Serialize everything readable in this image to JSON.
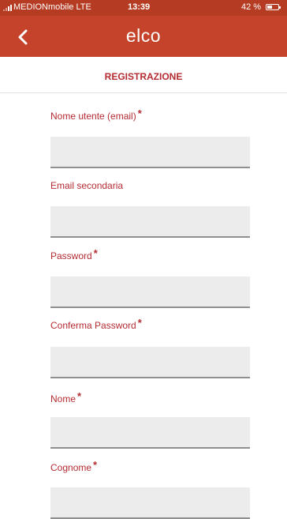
{
  "status_bar": {
    "carrier": "MEDIONmobile  LTE",
    "time": "13:39",
    "battery": "42 %"
  },
  "header": {
    "back_icon": "chevron-left-icon",
    "brand": "elco",
    "color": "#c5432a"
  },
  "page": {
    "title": "REGISTRAZIONE",
    "accent_color": "#b52b32"
  },
  "form": {
    "required_mark": "*",
    "fields": [
      {
        "label": "Nome utente (email)",
        "required": true,
        "value": ""
      },
      {
        "label": "Email secondaria",
        "required": false,
        "value": ""
      },
      {
        "label": "Password",
        "required": true,
        "value": ""
      },
      {
        "label": "Conferma Password",
        "required": true,
        "value": ""
      },
      {
        "label": "Nome",
        "required": true,
        "value": ""
      },
      {
        "label": "Cognome",
        "required": true,
        "value": ""
      }
    ]
  }
}
